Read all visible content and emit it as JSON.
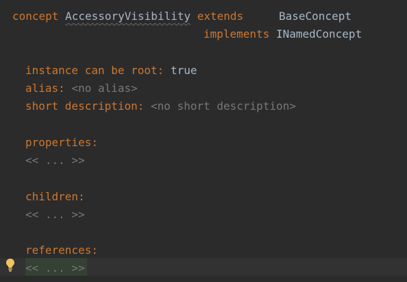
{
  "concept": {
    "keyword": "concept",
    "name": "AccessoryVisibility",
    "extends_keyword": "extends",
    "extends_value": "BaseConcept",
    "implements_keyword": "implements",
    "implements_value": "INamedConcept"
  },
  "props": {
    "root_label": "instance can be root:",
    "root_value": "true",
    "alias_label": "alias:",
    "alias_value": "<no alias>",
    "short_desc_label": "short description:",
    "short_desc_value": "<no short description>"
  },
  "sections": {
    "properties_label": "properties:",
    "properties_placeholder": "<< ... >>",
    "children_label": "children:",
    "children_placeholder": "<< ... >>",
    "references_label": "references:",
    "references_placeholder": "<< ... >>"
  },
  "colors": {
    "background": "#2b2b2b",
    "keyword": "#cc7832",
    "text": "#a9b7c6",
    "placeholder": "#787878",
    "intention_bulb": "#f2c55c"
  },
  "icons": {
    "intention": "lightbulb-icon"
  }
}
